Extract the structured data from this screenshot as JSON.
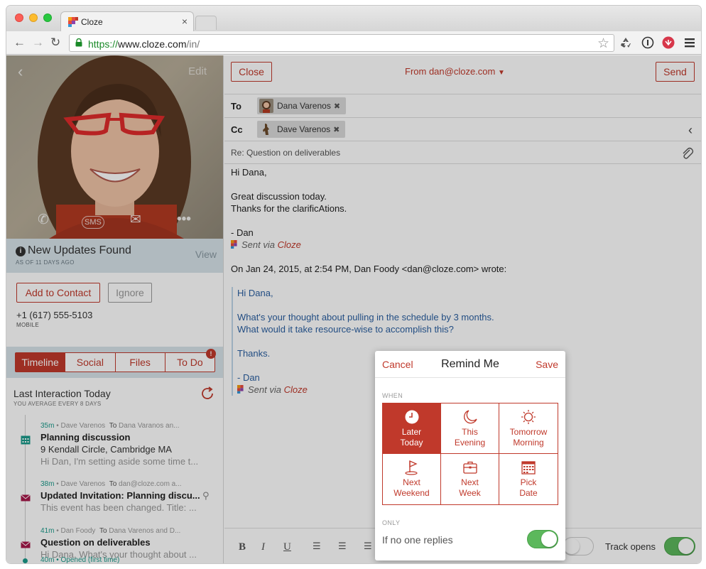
{
  "browser": {
    "tab_title": "Cloze",
    "url_scheme": "https://",
    "url_host": "www.cloze.com",
    "url_path": "/in/"
  },
  "contact": {
    "edit_label": "Edit",
    "updates_title": "New Updates Found",
    "updates_sub": "AS OF 11 DAYS AGO",
    "view_label": "View",
    "add_label": "Add to Contact",
    "ignore_label": "Ignore",
    "phone": "+1 (617) 555-5103",
    "phone_type": "MOBILE",
    "tabs": [
      {
        "label": "Timeline",
        "active": true
      },
      {
        "label": "Social",
        "active": false
      },
      {
        "label": "Files",
        "active": false
      },
      {
        "label": "To Do",
        "active": false,
        "badge": "!"
      }
    ],
    "last_interaction": "Last Interaction Today",
    "average": "YOU AVERAGE EVERY 8 DAYS"
  },
  "timeline": [
    {
      "time": "35m",
      "who": " • Dave Varenos",
      "to": "To",
      "to_who": " Dana Varanos an...",
      "title": "Planning discussion",
      "line2": "9 Kendall Circle, Cambridge MA",
      "line3": "Hi Dan, I'm setting aside some time t...",
      "icon": "calendar-icon"
    },
    {
      "time": "38m",
      "who": " • Dave Varenos",
      "to": "To",
      "to_who": " dan@cloze.com a...",
      "title": "Updated Invitation: Planning discu...",
      "line2": "This event has been changed. Title: ...",
      "icon": "envelope-icon"
    },
    {
      "time": "41m",
      "who": " • Dan Foody",
      "to": "To",
      "to_who": " Dana Varenos and D...",
      "title": "Question on deliverables",
      "line2": "Hi Dana, What's your thought about ...",
      "icon": "envelope-icon"
    },
    {
      "time": "40m",
      "who": " • Opened (first time)"
    }
  ],
  "compose": {
    "close_label": "Close",
    "from_label": "From dan@cloze.com",
    "send_label": "Send",
    "to_label": "To",
    "to_name": "Dana Varenos",
    "cc_label": "Cc",
    "cc_name": "Dave Varenos",
    "subject": "Re: Question on deliverables",
    "greeting": "Hi Dana,",
    "line1": "Great discussion today.",
    "line2": "Thanks for the clarificAtions.",
    "signoff": "- Dan",
    "sent_via": "Sent via ",
    "sent_via_brand": "Cloze",
    "quote_header": "On Jan 24, 2015, at 2:54 PM, Dan Foody <dan@cloze.com> wrote:",
    "q_greeting": "Hi Dana,",
    "q_line1": "What's your thought about pulling in the schedule by 3 months.",
    "q_line2": "What would it take resource-wise to accomplish this?",
    "q_thanks": "Thanks.",
    "q_signoff": "- Dan",
    "track_label": "Track opens"
  },
  "remind": {
    "cancel": "Cancel",
    "title": "Remind Me",
    "save": "Save",
    "when_label": "WHEN",
    "options": [
      {
        "l1": "Later",
        "l2": "Today",
        "active": true,
        "icon": "clock-icon"
      },
      {
        "l1": "This",
        "l2": "Evening",
        "active": false,
        "icon": "moon-icon"
      },
      {
        "l1": "Tomorrow",
        "l2": "Morning",
        "active": false,
        "icon": "sun-icon"
      },
      {
        "l1": "Next",
        "l2": "Weekend",
        "active": false,
        "icon": "golf-flag-icon"
      },
      {
        "l1": "Next",
        "l2": "Week",
        "active": false,
        "icon": "briefcase-icon"
      },
      {
        "l1": "Pick",
        "l2": "Date",
        "active": false,
        "icon": "calendar-grid-icon"
      }
    ],
    "only_label": "ONLY",
    "no_reply": "If no one replies"
  },
  "colors": {
    "accent": "#c0392b",
    "toggle_on": "#5cb85c",
    "panel": "#d7e3ea"
  }
}
